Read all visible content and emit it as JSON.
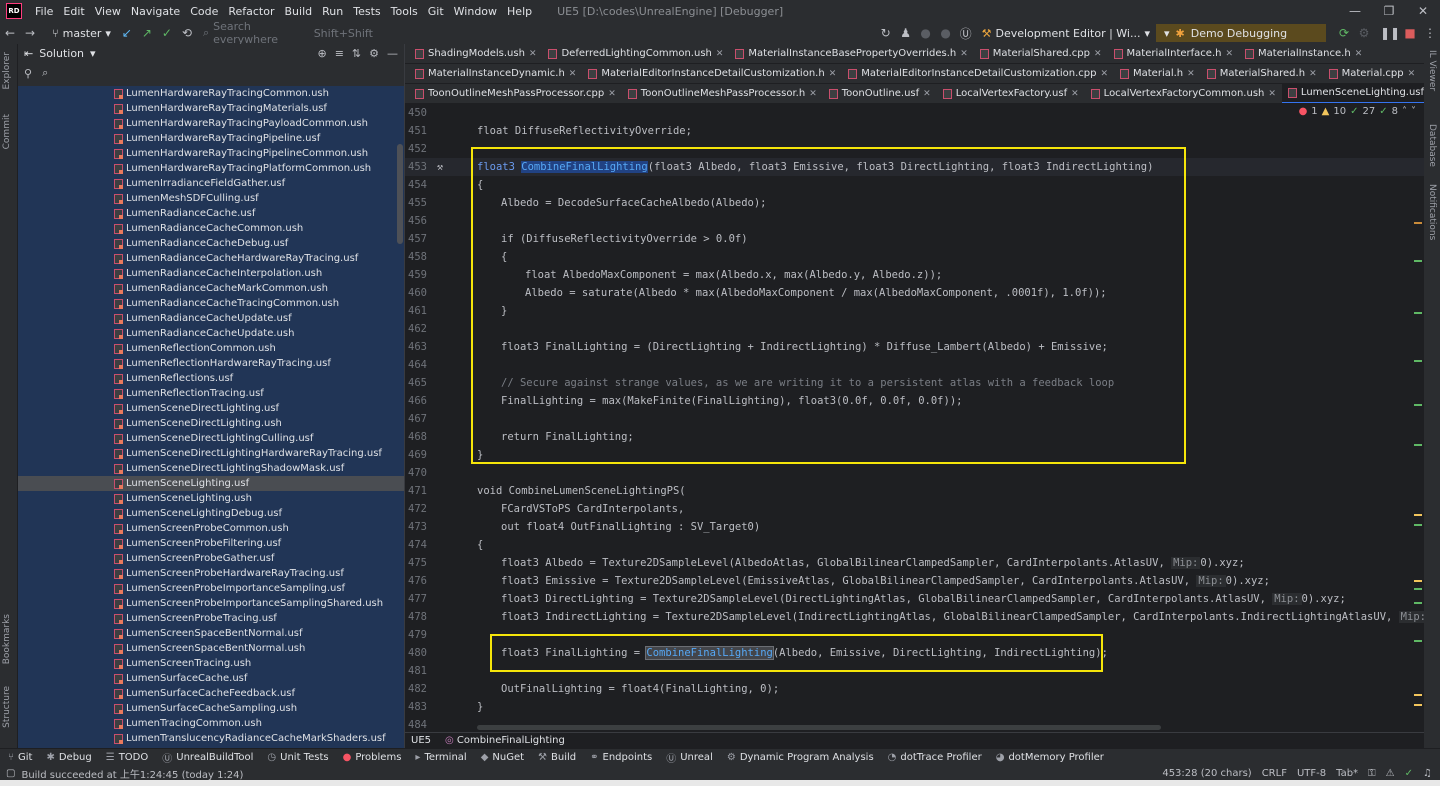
{
  "menubar": {
    "logo": "RD",
    "items": [
      "File",
      "Edit",
      "View",
      "Navigate",
      "Code",
      "Refactor",
      "Build",
      "Run",
      "Tests",
      "Tools",
      "Git",
      "Window",
      "Help"
    ],
    "title": "UE5 [D:\\codes\\UnrealEngine] [Debugger]"
  },
  "toolbar": {
    "branch": "master",
    "search_placeholder": "Search everywhere",
    "search_shortcut": "Shift+Shift",
    "config": "Development Editor | Wi...",
    "debug_config": "Demo Debugging"
  },
  "left_strip": {
    "explorer": "Explorer",
    "commit": "Commit",
    "bookmarks": "Bookmarks",
    "structure": "Structure"
  },
  "right_strip": {
    "il_viewer": "IL Viewer",
    "database": "Database",
    "notifications": "Notifications"
  },
  "solution": {
    "title": "Solution",
    "files": [
      "LumenHardwareRayTracingCommon.ush",
      "LumenHardwareRayTracingMaterials.usf",
      "LumenHardwareRayTracingPayloadCommon.ush",
      "LumenHardwareRayTracingPipeline.usf",
      "LumenHardwareRayTracingPipelineCommon.ush",
      "LumenHardwareRayTracingPlatformCommon.ush",
      "LumenIrradianceFieldGather.usf",
      "LumenMeshSDFCulling.usf",
      "LumenRadianceCache.usf",
      "LumenRadianceCacheCommon.ush",
      "LumenRadianceCacheDebug.usf",
      "LumenRadianceCacheHardwareRayTracing.usf",
      "LumenRadianceCacheInterpolation.ush",
      "LumenRadianceCacheMarkCommon.ush",
      "LumenRadianceCacheTracingCommon.ush",
      "LumenRadianceCacheUpdate.usf",
      "LumenRadianceCacheUpdate.ush",
      "LumenReflectionCommon.ush",
      "LumenReflectionHardwareRayTracing.usf",
      "LumenReflections.usf",
      "LumenReflectionTracing.usf",
      "LumenSceneDirectLighting.usf",
      "LumenSceneDirectLighting.ush",
      "LumenSceneDirectLightingCulling.usf",
      "LumenSceneDirectLightingHardwareRayTracing.usf",
      "LumenSceneDirectLightingShadowMask.usf",
      "LumenSceneLighting.usf",
      "LumenSceneLighting.ush",
      "LumenSceneLightingDebug.usf",
      "LumenScreenProbeCommon.ush",
      "LumenScreenProbeFiltering.usf",
      "LumenScreenProbeGather.usf",
      "LumenScreenProbeHardwareRayTracing.usf",
      "LumenScreenProbeImportanceSampling.usf",
      "LumenScreenProbeImportanceSamplingShared.ush",
      "LumenScreenProbeTracing.usf",
      "LumenScreenSpaceBentNormal.usf",
      "LumenScreenSpaceBentNormal.ush",
      "LumenScreenTracing.ush",
      "LumenSurfaceCache.usf",
      "LumenSurfaceCacheFeedback.usf",
      "LumenSurfaceCacheSampling.ush",
      "LumenTracingCommon.ush",
      "LumenTranslucencyRadianceCacheMarkShaders.usf"
    ],
    "selected": "LumenSceneLighting.usf"
  },
  "tabs": {
    "row1": [
      "ShadingModels.ush",
      "DeferredLightingCommon.ush",
      "MaterialInstanceBasePropertyOverrides.h",
      "MaterialShared.cpp",
      "MaterialInterface.h",
      "MaterialInstance.h"
    ],
    "row2": [
      "MaterialInstanceDynamic.h",
      "MaterialEditorInstanceDetailCustomization.h",
      "MaterialEditorInstanceDetailCustomization.cpp",
      "Material.h",
      "MaterialShared.h",
      "Material.cpp"
    ],
    "row3": [
      "ToonOutlineMeshPassProcessor.cpp",
      "ToonOutlineMeshPassProcessor.h",
      "ToonOutline.usf",
      "LocalVertexFactory.usf",
      "LocalVertexFactoryCommon.ush",
      "LumenSceneLighting.usf"
    ],
    "active": "LumenSceneLighting.usf"
  },
  "inspections": {
    "errors": "1",
    "warnings": "10",
    "weak": "27",
    "hints": "8"
  },
  "editor": {
    "line_numbers": [
      "450",
      "451",
      "452",
      "453",
      "454",
      "455",
      "456",
      "457",
      "458",
      "459",
      "460",
      "461",
      "462",
      "463",
      "464",
      "465",
      "466",
      "467",
      "468",
      "469",
      "470",
      "471",
      "472",
      "473",
      "474",
      "475",
      "476",
      "477",
      "478",
      "479",
      "480",
      "481",
      "482",
      "483",
      "484"
    ],
    "line_451": "float DiffuseReflectivityOverride;",
    "fn_name": "CombineFinalLighting",
    "fn_params": "(float3 Albedo, float3 Emissive, float3 DirectLighting, float3 IndirectLighting)",
    "line_455": "Albedo = DecodeSurfaceCacheAlbedo(Albedo);",
    "line_457": "if (DiffuseReflectivityOverride > 0.0f)",
    "line_459": "float AlbedoMaxComponent = max(Albedo.x, max(Albedo.y, Albedo.z));",
    "line_460": "Albedo = saturate(Albedo * max(AlbedoMaxComponent / max(AlbedoMaxComponent, .0001f), 1.0f));",
    "line_463": "float3 FinalLighting = (DirectLighting + IndirectLighting) * Diffuse_Lambert(Albedo) + Emissive;",
    "line_465": "// Secure against strange values, as we are writing it to a persistent atlas with a feedback loop",
    "line_466": "FinalLighting = max(MakeFinite(FinalLighting), float3(0.0f, 0.0f, 0.0f));",
    "line_468": "return FinalLighting;",
    "line_471": "void CombineLumenSceneLightingPS(",
    "line_472": "FCardVSToPS CardInterpolants,",
    "line_473": "out float4 OutFinalLighting : SV_Target0)",
    "line_475_a": "float3 Albedo = Texture2DSampleLevel(AlbedoAtlas, GlobalBilinearClampedSampler, CardInterpolants.AtlasUV, ",
    "line_476_a": "float3 Emissive = Texture2DSampleLevel(EmissiveAtlas, GlobalBilinearClampedSampler, CardInterpolants.AtlasUV, ",
    "line_477_a": "float3 DirectLighting = Texture2DSampleLevel(DirectLightingAtlas, GlobalBilinearClampedSampler, CardInterpolants.AtlasUV, ",
    "line_478_a": "float3 IndirectLighting = Texture2DSampleLevel(IndirectLightingAtlas, GlobalBilinearClampedSampler, CardInterpolants.IndirectLightingAtlasUV, ",
    "mip_hint": "Mip:",
    "mip_tail": "0).xyz;",
    "line_480_a": "float3 FinalLighting = ",
    "line_480_b": "(Albedo, Emissive, DirectLighting, IndirectLighting);",
    "line_482": "OutFinalLighting = float4(FinalLighting, 0);"
  },
  "breadcrumb": {
    "project": "UE5",
    "symbol": "CombineFinalLighting"
  },
  "bottom_tools": [
    "Git",
    "Debug",
    "TODO",
    "UnrealBuildTool",
    "Unit Tests",
    "Problems",
    "Terminal",
    "NuGet",
    "Build",
    "Endpoints",
    "Unreal",
    "Dynamic Program Analysis",
    "dotTrace Profiler",
    "dotMemory Profiler"
  ],
  "status": {
    "message": "Build succeeded at 上午1:24:45  (today 1:24)",
    "position": "453:28 (20 chars)",
    "line_ending": "CRLF",
    "encoding": "UTF-8",
    "indent": "Tab*"
  }
}
